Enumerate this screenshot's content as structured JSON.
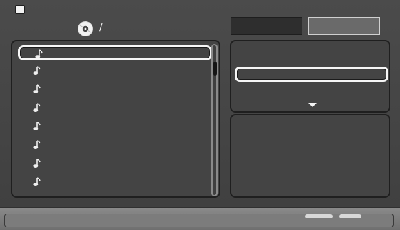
{
  "header": {
    "path_text": "/"
  },
  "tabs": [
    {
      "label": ""
    },
    {
      "label": ""
    }
  ],
  "file_list": {
    "items": [
      {
        "label": "",
        "icon": "music-note-icon",
        "selected": true
      },
      {
        "label": "",
        "icon": "music-note-icon",
        "selected": false
      },
      {
        "label": "",
        "icon": "music-note-icon",
        "selected": false
      },
      {
        "label": "",
        "icon": "music-note-icon",
        "selected": false
      },
      {
        "label": "",
        "icon": "music-note-icon",
        "selected": false
      },
      {
        "label": "",
        "icon": "music-note-icon",
        "selected": false
      },
      {
        "label": "",
        "icon": "music-note-icon",
        "selected": false
      },
      {
        "label": "",
        "icon": "music-note-icon",
        "selected": false
      }
    ]
  },
  "options_panel": {
    "selected_label": "",
    "down_arrow_icon": "down-arrow-icon"
  },
  "info_panel": {
    "text": ""
  },
  "bottom_bar": {
    "text": ""
  }
}
